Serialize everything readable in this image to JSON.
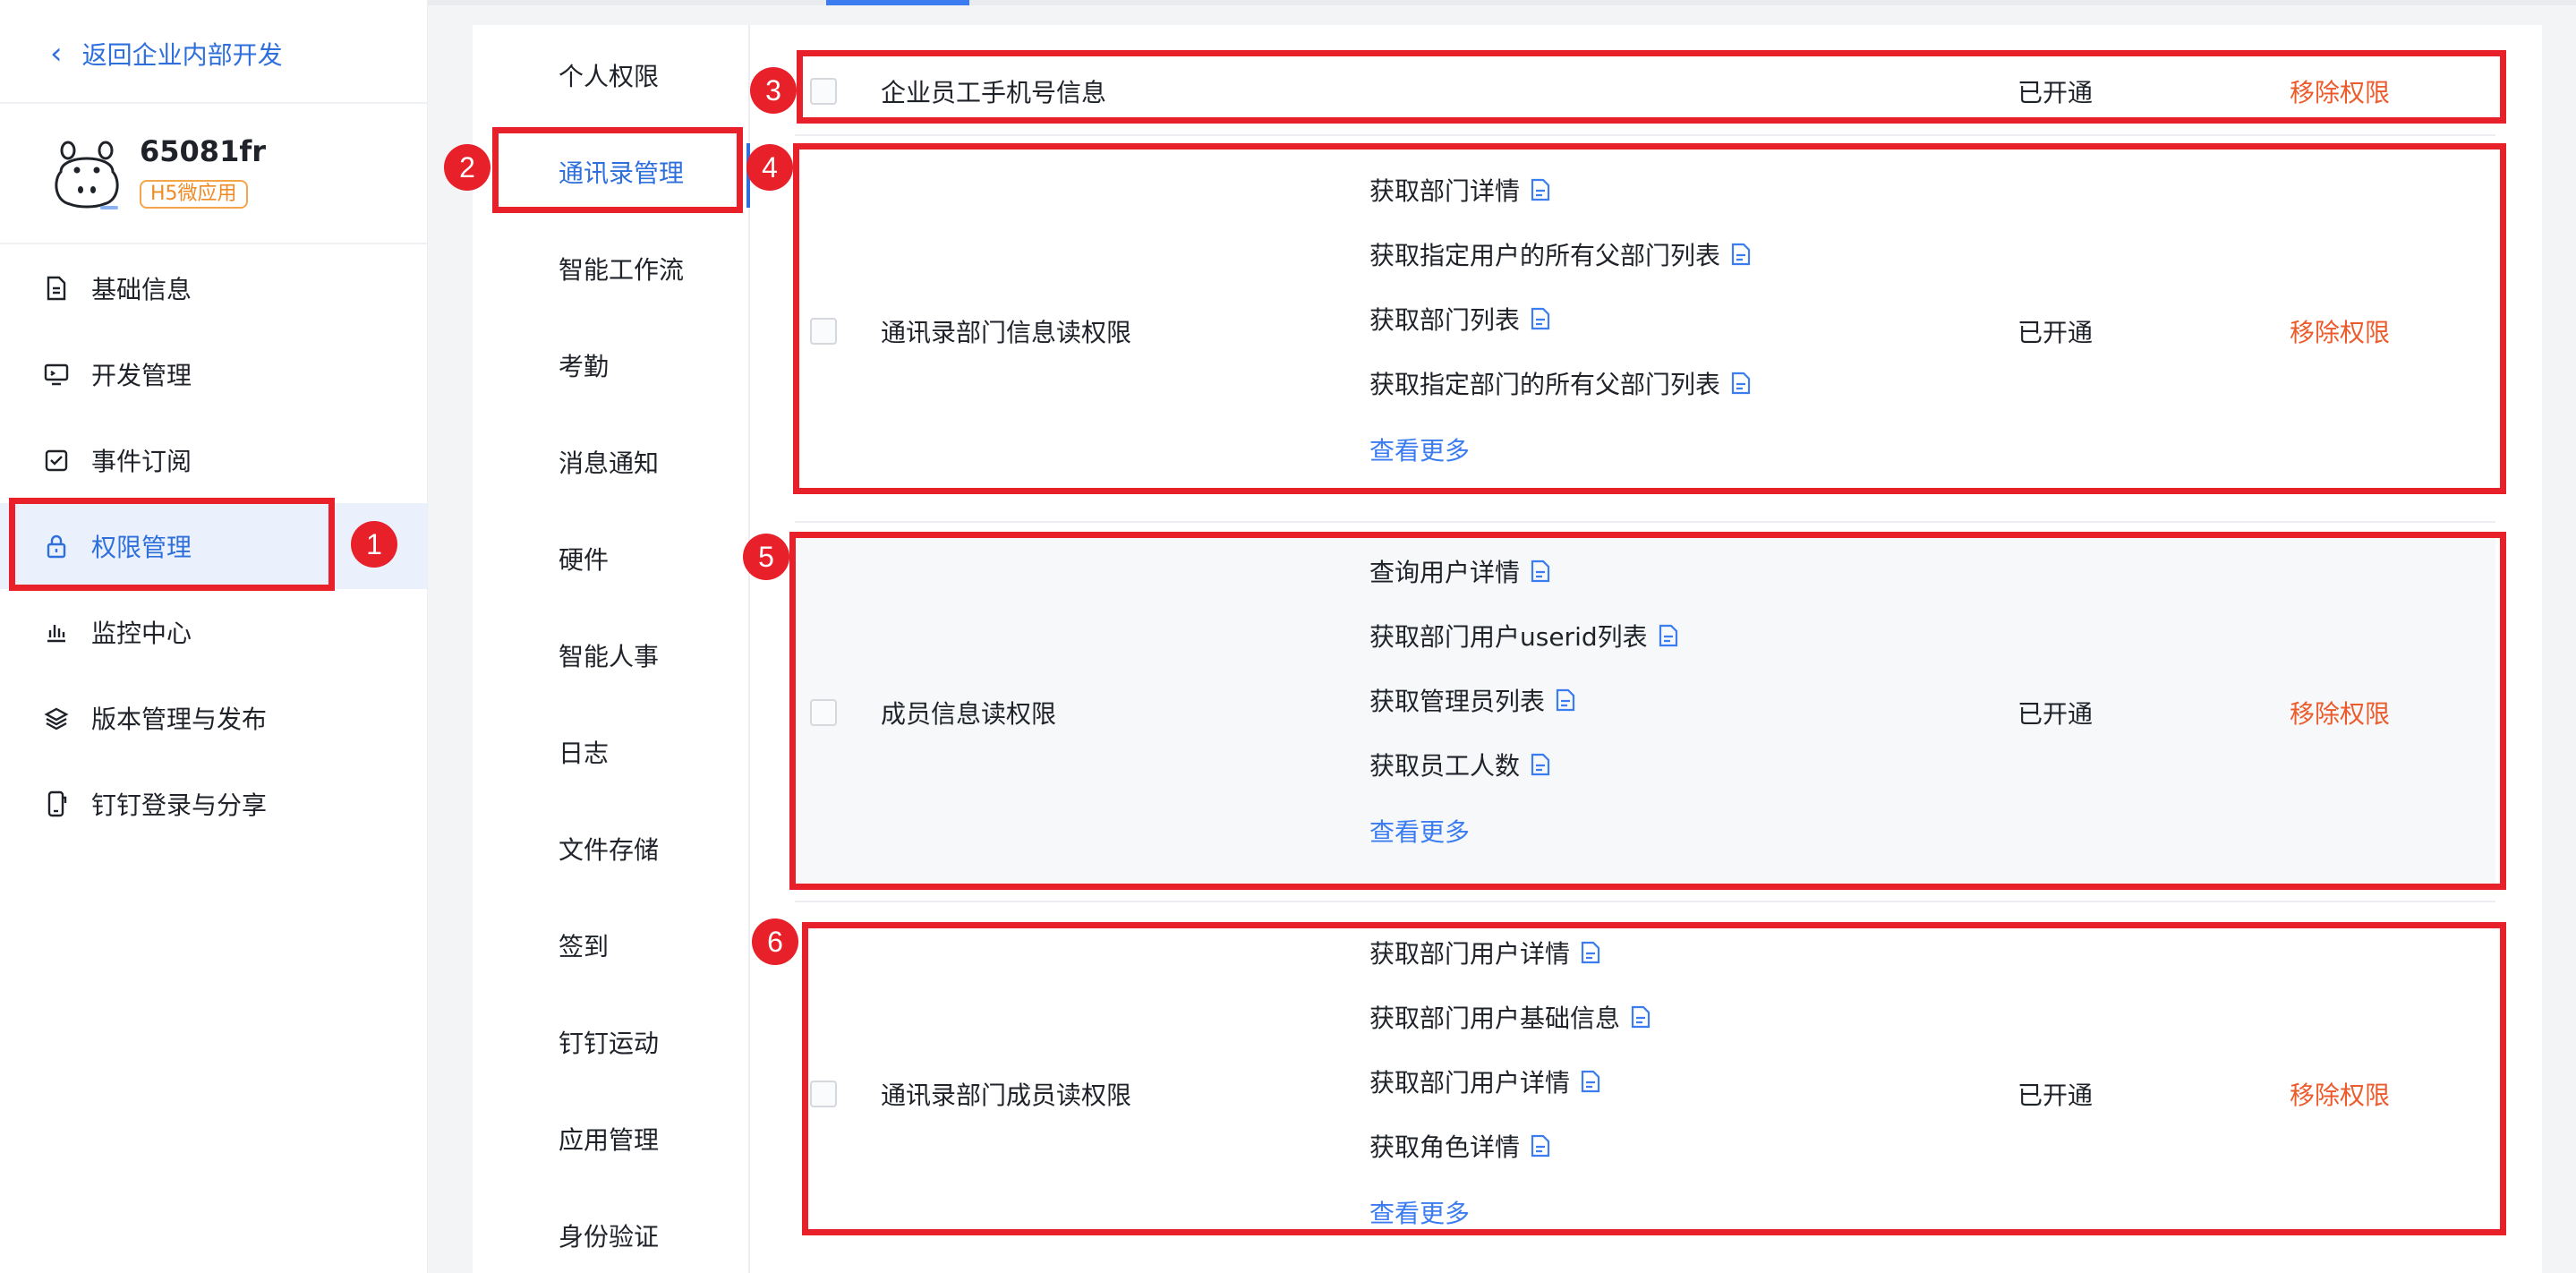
{
  "sidebar": {
    "back_label": "返回企业内部开发",
    "app_name": "65081fr",
    "app_badge": "H5微应用",
    "items": [
      {
        "label": "基础信息",
        "icon": "document-icon"
      },
      {
        "label": "开发管理",
        "icon": "monitor-icon"
      },
      {
        "label": "事件订阅",
        "icon": "subscribe-icon"
      },
      {
        "label": "权限管理",
        "icon": "lock-icon",
        "active": true
      },
      {
        "label": "监控中心",
        "icon": "bar-chart-icon"
      },
      {
        "label": "版本管理与发布",
        "icon": "layers-icon"
      },
      {
        "label": "钉钉登录与分享",
        "icon": "phone-share-icon"
      }
    ]
  },
  "categories": [
    "个人权限",
    "通讯录管理",
    "智能工作流",
    "考勤",
    "消息通知",
    "硬件",
    "智能人事",
    "日志",
    "文件存储",
    "签到",
    "钉钉运动",
    "应用管理",
    "身份验证"
  ],
  "active_category": "通讯录管理",
  "permissions": [
    {
      "name": "企业员工手机号信息",
      "apis": [],
      "status": "已开通",
      "action": "移除权限"
    },
    {
      "name": "通讯录部门信息读权限",
      "apis": [
        "获取部门详情",
        "获取指定用户的所有父部门列表",
        "获取部门列表",
        "获取指定部门的所有父部门列表"
      ],
      "more": "查看更多",
      "status": "已开通",
      "action": "移除权限"
    },
    {
      "name": "成员信息读权限",
      "apis": [
        "查询用户详情",
        "获取部门用户userid列表",
        "获取管理员列表",
        "获取员工人数"
      ],
      "more": "查看更多",
      "status": "已开通",
      "action": "移除权限"
    },
    {
      "name": "通讯录部门成员读权限",
      "apis": [
        "获取部门用户详情",
        "获取部门用户基础信息",
        "获取部门用户详情",
        "获取角色详情"
      ],
      "more": "查看更多",
      "status": "已开通",
      "action": "移除权限"
    }
  ],
  "annotations": [
    "1",
    "2",
    "3",
    "4",
    "5",
    "6"
  ],
  "colors": {
    "accent": "#2f6fdb",
    "remove": "#ec5b2c",
    "annotation": "#e8202a",
    "badge_orange": "#f08a24"
  }
}
